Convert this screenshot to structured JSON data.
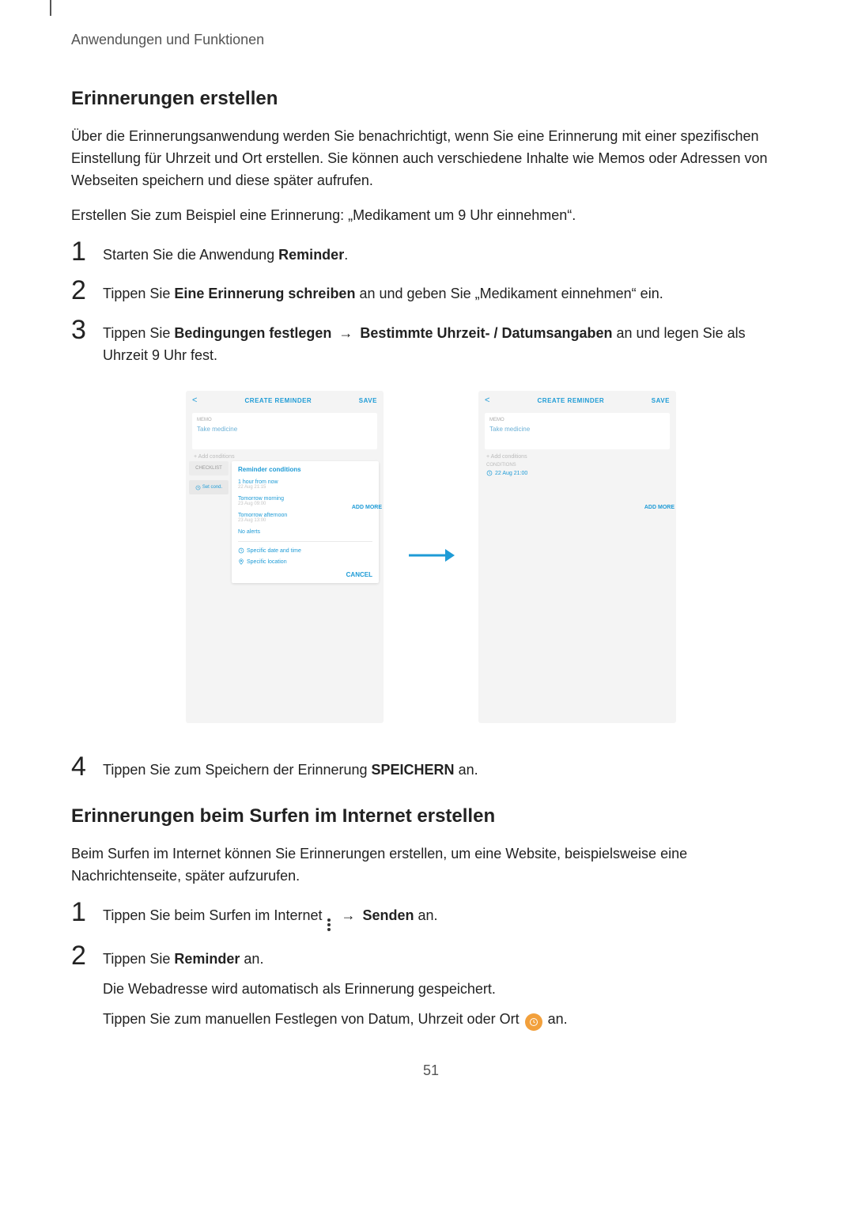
{
  "header": {
    "section_label": "Anwendungen und Funktionen"
  },
  "sections": {
    "a": {
      "title": "Erinnerungen erstellen",
      "intro": "Über die Erinnerungsanwendung werden Sie benachrichtigt, wenn Sie eine Erinnerung mit einer spezifischen Einstellung für Uhrzeit und Ort erstellen. Sie können auch verschiedene Inhalte wie Memos oder Adressen von Webseiten speichern und diese später aufrufen.",
      "example": "Erstellen Sie zum Beispiel eine Erinnerung: „Medikament um 9 Uhr einnehmen“.",
      "step1": {
        "num": "1",
        "pre": "Starten Sie die Anwendung ",
        "b1": "Reminder",
        "post": "."
      },
      "step2": {
        "num": "2",
        "pre": "Tippen Sie ",
        "b1": "Eine Erinnerung schreiben",
        "post": " an und geben Sie „Medikament einnehmen“ ein."
      },
      "step3": {
        "num": "3",
        "pre": "Tippen Sie ",
        "b1": "Bedingungen festlegen",
        "arrow": " → ",
        "b2": "Bestimmte Uhrzeit- / Datumsangaben",
        "post": " an und legen Sie als Uhrzeit 9 Uhr fest."
      },
      "step4": {
        "num": "4",
        "pre": "Tippen Sie zum Speichern der Erinnerung ",
        "b1": "SPEICHERN",
        "post": " an."
      }
    },
    "b": {
      "title": "Erinnerungen beim Surfen im Internet erstellen",
      "intro": "Beim Surfen im Internet können Sie Erinnerungen erstellen, um eine Website, beispielsweise eine Nachrichtenseite, später aufzurufen.",
      "step1": {
        "num": "1",
        "pre": "Tippen Sie beim Surfen im Internet ",
        "arrow": " → ",
        "b1": "Senden",
        "post": " an."
      },
      "step2": {
        "num": "2",
        "pre": "Tippen Sie ",
        "b1": "Reminder",
        "post": " an.",
        "sub1": "Die Webadresse wird automatisch als Erinnerung gespeichert.",
        "sub2_pre": "Tippen Sie zum manuellen Festlegen von Datum, Uhrzeit oder Ort ",
        "sub2_post": " an."
      }
    }
  },
  "phones": {
    "left": {
      "back": "<",
      "title": "CREATE REMINDER",
      "save": "SAVE",
      "memo_label": "MEMO",
      "memo_text": "Take medicine",
      "add_cond": "+  Add conditions",
      "tab_checklist": "CHECKLIST",
      "tab_setcond": "Set cond.",
      "dd_title": "Reminder conditions",
      "opt1_main": "1 hour from now",
      "opt1_sub": "22 Aug 21:15",
      "opt2_main": "Tomorrow morning",
      "opt2_sub": "23 Aug 09:00",
      "opt3_main": "Tomorrow afternoon",
      "opt3_sub": "23 Aug 13:00",
      "opt4_main": "No alerts",
      "row_date": "Specific date and time",
      "row_loc": "Specific location",
      "cancel": "CANCEL",
      "more": "ADD MORE"
    },
    "right": {
      "back": "<",
      "title": "CREATE REMINDER",
      "save": "SAVE",
      "memo_label": "MEMO",
      "memo_text": "Take medicine",
      "add_cond": "+  Add conditions",
      "cond_label": "CONDITIONS",
      "chip_text": "22 Aug 21:00",
      "more": "ADD MORE"
    }
  },
  "page_number": "51"
}
